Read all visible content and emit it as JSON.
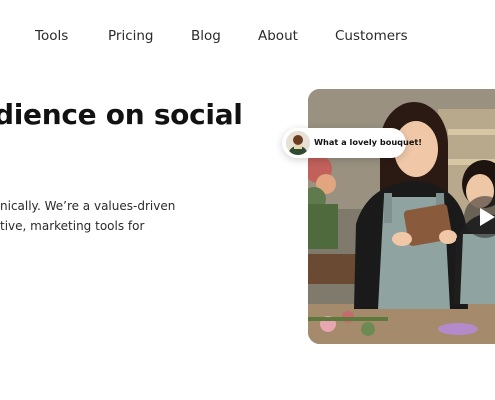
{
  "nav": {
    "items": [
      {
        "label": "Tools"
      },
      {
        "label": "Pricing"
      },
      {
        "label": "Blog"
      },
      {
        "label": "About"
      },
      {
        "label": "Customers"
      }
    ]
  },
  "hero": {
    "title": "dience on social",
    "description_lines": [
      "nically. We’re a values-driven",
      "tive, marketing tools for"
    ]
  },
  "media": {
    "chat_bubble_text": "What a lovely bouquet!",
    "play_icon": "play-icon"
  },
  "colors": {
    "text": "#1b1b1b",
    "background": "#ffffff"
  }
}
